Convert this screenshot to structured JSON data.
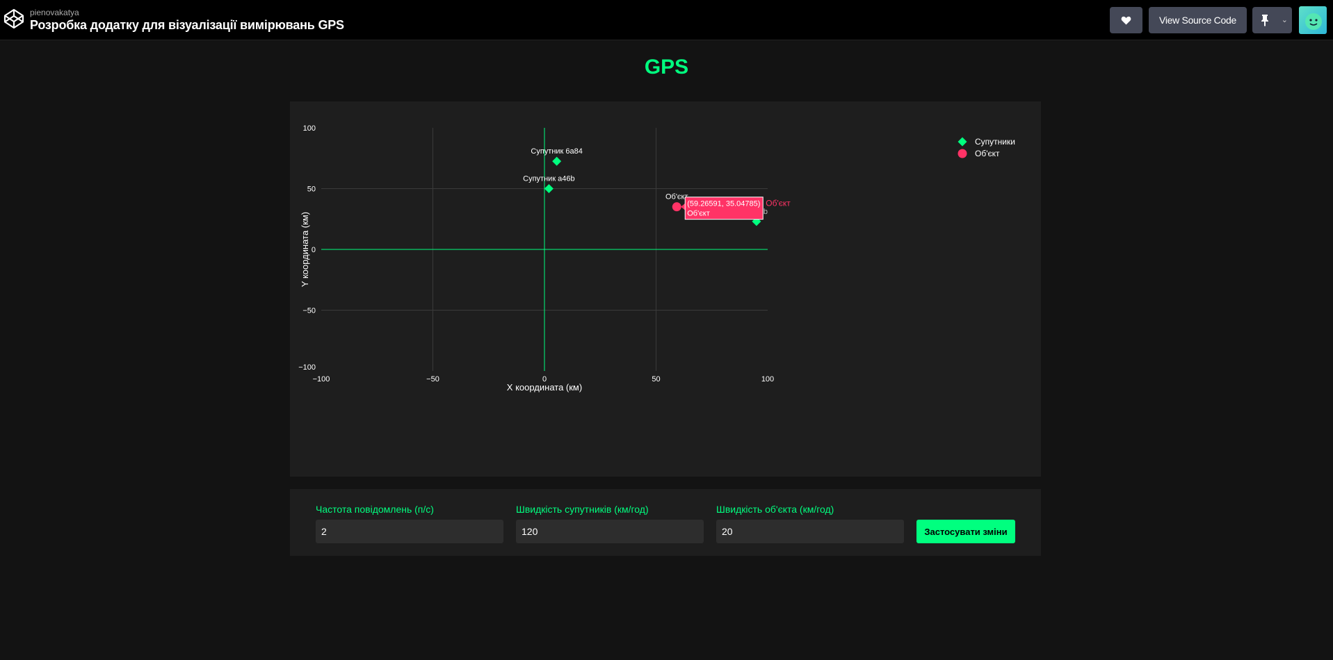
{
  "header": {
    "author": "pienovakatya",
    "title": "Розробка додатку для візуалізації вимірювань GPS",
    "view_source_label": "View Source Code"
  },
  "page": {
    "heading": "GPS"
  },
  "chart_data": {
    "type": "scatter",
    "title": "",
    "xlabel": "X координата (км)",
    "ylabel": "Y координата (км)",
    "xlim": [
      -100,
      100
    ],
    "ylim": [
      -100,
      100
    ],
    "x_ticks": [
      -100,
      -50,
      0,
      50,
      100
    ],
    "y_ticks": [
      100,
      50,
      0,
      -50,
      -100
    ],
    "x_tick_labels": [
      "−100",
      "−50",
      "0",
      "50",
      "100"
    ],
    "y_tick_labels": [
      "100",
      "50",
      "0",
      "−50",
      "−100"
    ],
    "grid": true,
    "legend_position": "top-right",
    "series": [
      {
        "name": "Супутники",
        "marker": "diamond",
        "color": "#00ff7f",
        "points": [
          {
            "x": 5.5,
            "y": 72.5,
            "label": "Супутник 6a84"
          },
          {
            "x": 2,
            "y": 50,
            "label": "Супутник a46b"
          },
          {
            "x": 95,
            "y": 23,
            "label": "Супутник b"
          }
        ]
      },
      {
        "name": "Об'єкт",
        "marker": "circle",
        "color": "#ff3366",
        "points": [
          {
            "x": 59.26591,
            "y": 35.04785,
            "label": "Об'єкт"
          }
        ]
      }
    ],
    "tooltip": {
      "value": "(59.26591, 35.04785)",
      "name": "Об'єкт",
      "series": "Об'єкт"
    }
  },
  "controls": {
    "frequency": {
      "label": "Частота повідомлень (п/с)",
      "value": "2"
    },
    "satellite_speed": {
      "label": "Швидкість супутників (км/год)",
      "value": "120"
    },
    "object_speed": {
      "label": "Швидкість об'єкта (км/год)",
      "value": "20"
    },
    "apply_label": "Застосувати зміни"
  },
  "colors": {
    "accent": "#00ff7f",
    "object": "#ff3366"
  }
}
